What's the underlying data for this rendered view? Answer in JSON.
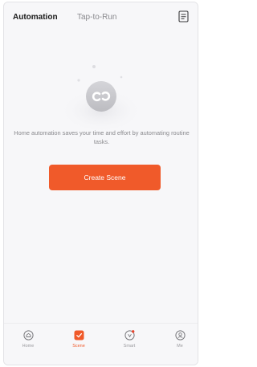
{
  "header": {
    "tabs": [
      {
        "label": "Automation",
        "active": true
      },
      {
        "label": "Tap-to-Run",
        "active": false
      }
    ],
    "right_icon": "document-list-icon"
  },
  "empty_state": {
    "icon": "link-chain-icon",
    "message": "Home automation saves your time and effort by automating routine tasks.",
    "button_label": "Create Scene"
  },
  "bottom_nav": {
    "items": [
      {
        "label": "Home",
        "icon": "home-icon",
        "active": false
      },
      {
        "label": "Scene",
        "icon": "scene-icon",
        "active": true
      },
      {
        "label": "Smart",
        "icon": "smart-icon",
        "active": false,
        "badge": true
      },
      {
        "label": "Me",
        "icon": "profile-icon",
        "active": false
      }
    ]
  },
  "colors": {
    "accent": "#f05a2a",
    "background": "#f7f7f9",
    "text_primary": "#1a1a1a",
    "text_secondary": "#8a8a8e",
    "badge": "#e8442c"
  }
}
